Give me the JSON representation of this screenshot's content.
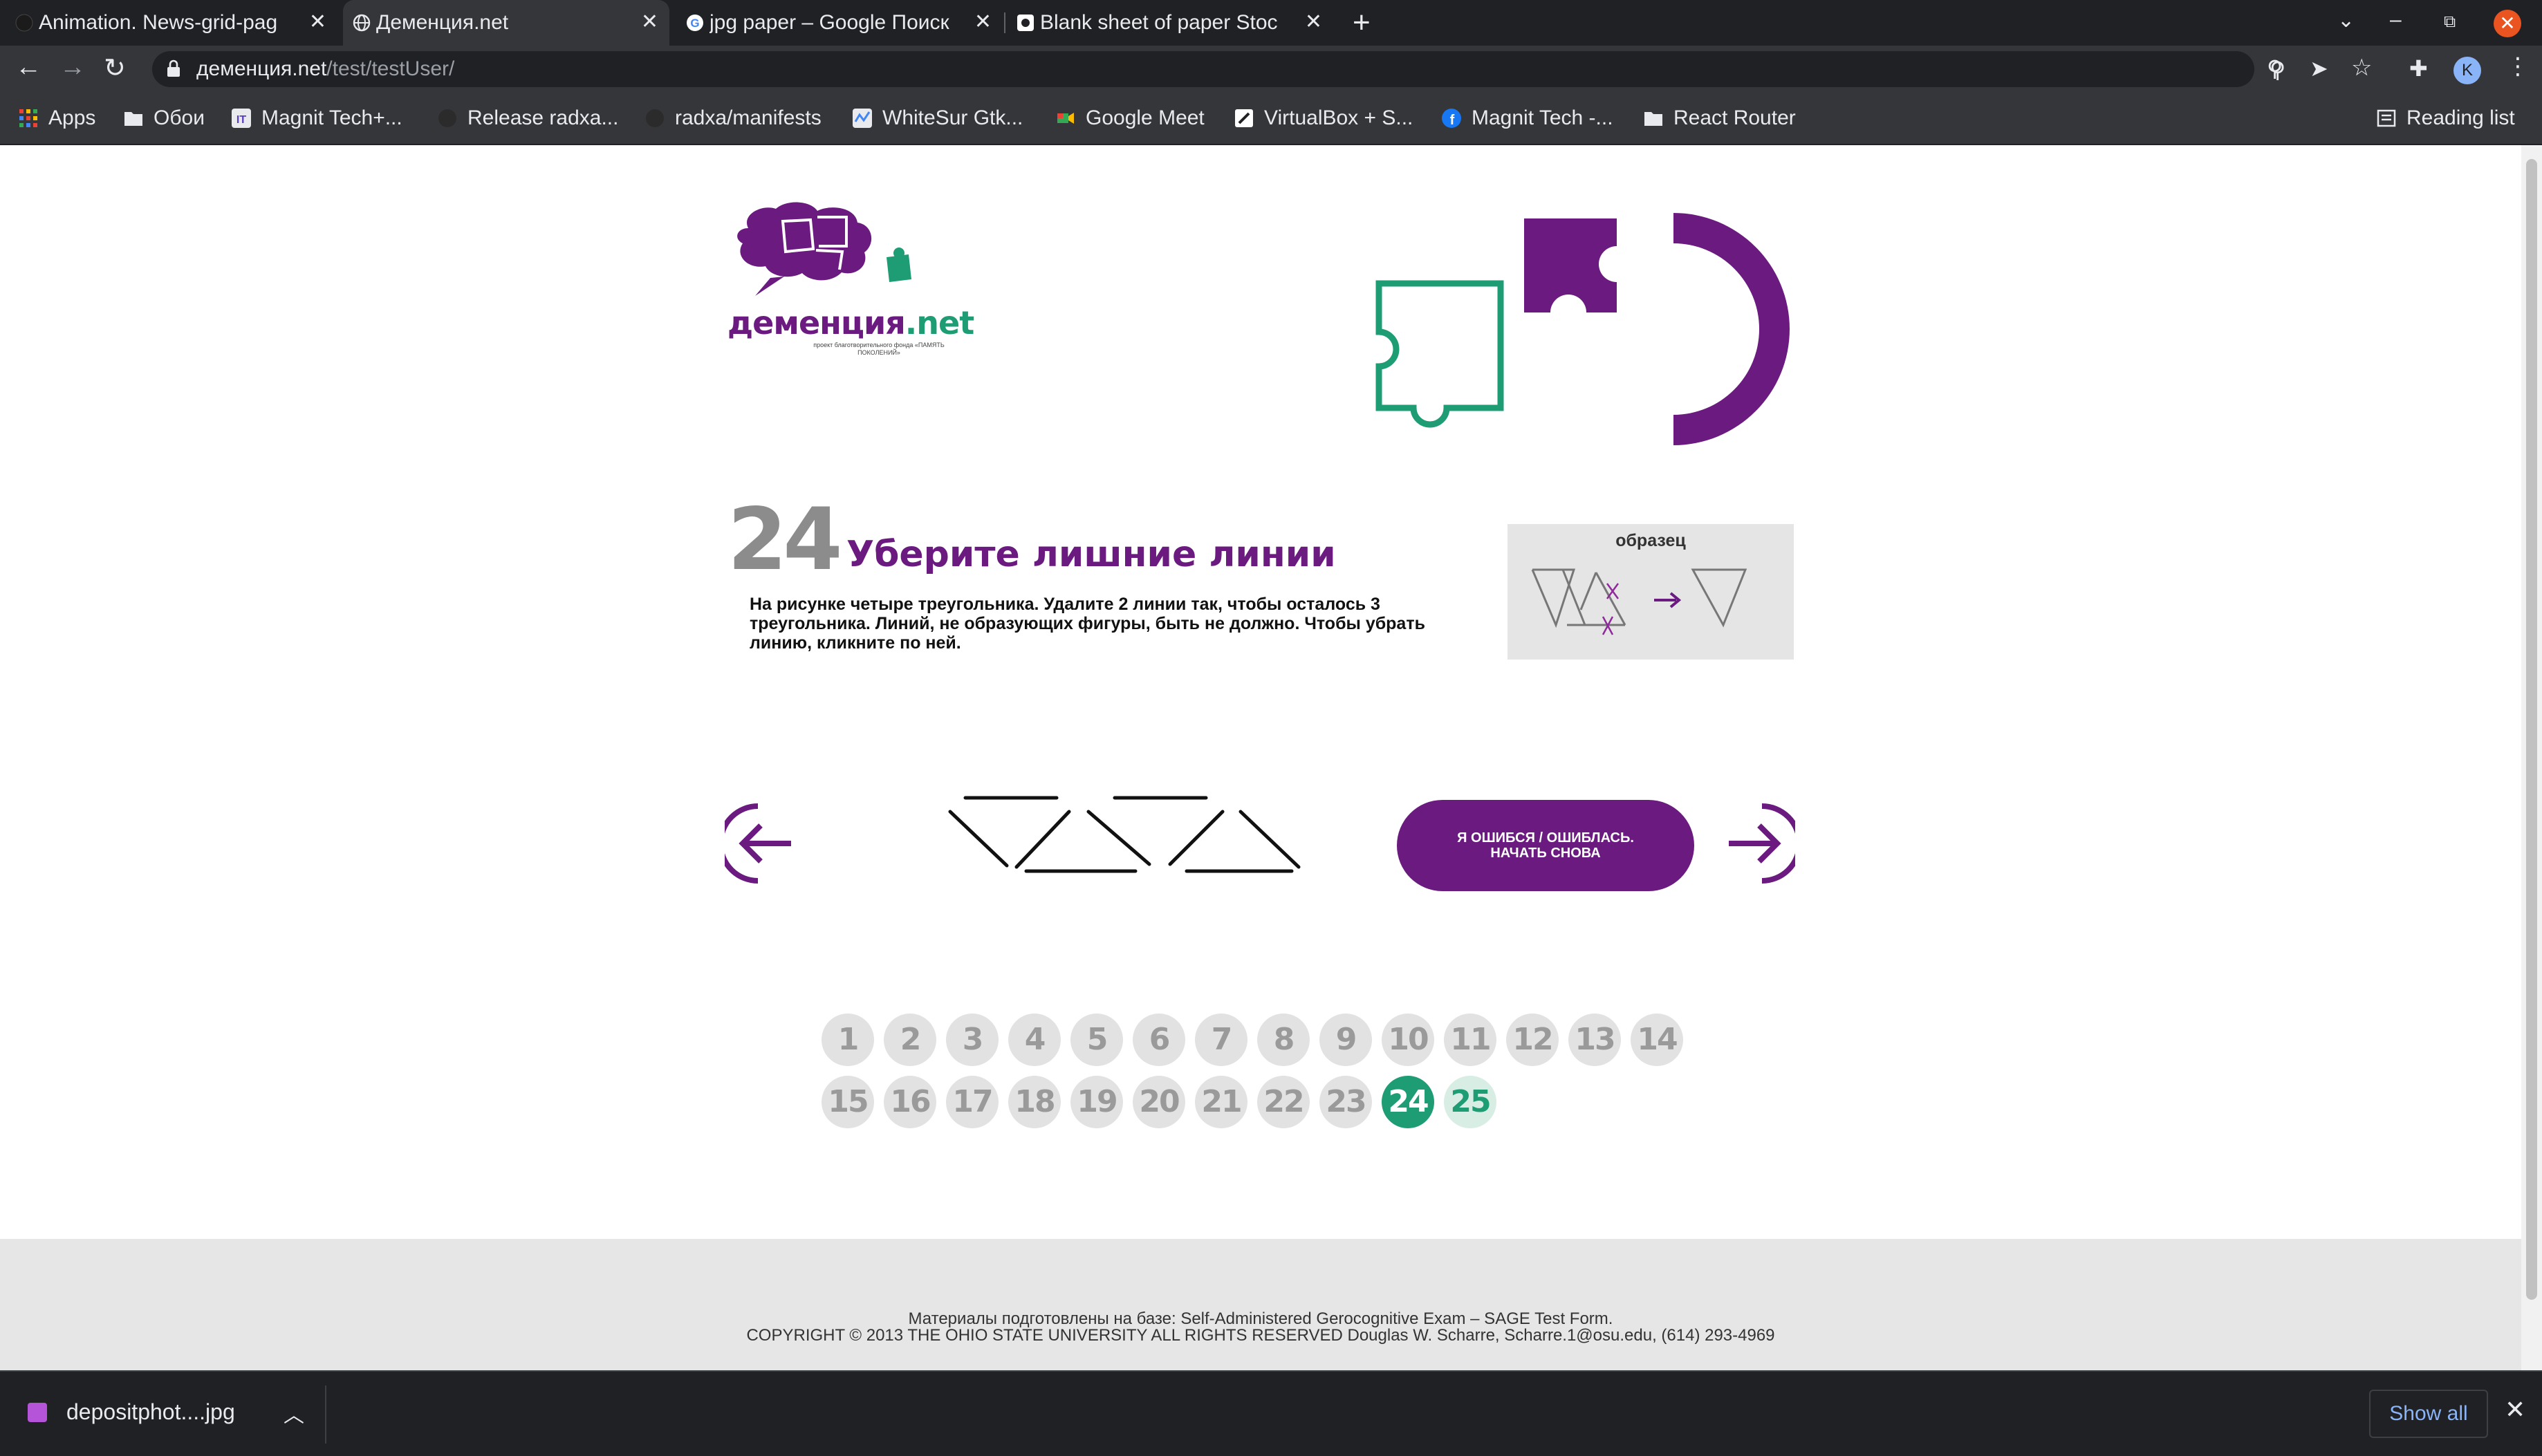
{
  "browser": {
    "tabs": [
      {
        "label": "Animation. News-grid-pag",
        "icon": "github-icon",
        "active": false
      },
      {
        "label": "Деменция.net",
        "icon": "globe-icon",
        "active": true
      },
      {
        "label": "jpg paper – Google Поиск",
        "icon": "google-icon",
        "active": false
      },
      {
        "label": "Blank sheet of paper Stoc",
        "icon": "depositphotos-icon",
        "active": false
      }
    ],
    "new_tab": "+",
    "window_controls": {
      "chevron": "⌄",
      "minimize": "–",
      "restore": "⧉",
      "close": "✕"
    },
    "url_host": "деменция.net",
    "url_path": "/test/testUser/",
    "avatar_letter": "K",
    "bookmarks": [
      {
        "label": "Apps",
        "icon": "apps-grid-icon"
      },
      {
        "label": "Обои",
        "icon": "folder-icon"
      },
      {
        "label": "Magnit Tech+...",
        "icon": "magnit-icon"
      },
      {
        "label": "Release radxa...",
        "icon": "github-icon"
      },
      {
        "label": "radxa/manifests",
        "icon": "github-icon"
      },
      {
        "label": "WhiteSur Gtk...",
        "icon": "whitesur-icon"
      },
      {
        "label": "Google Meet",
        "icon": "meet-icon"
      },
      {
        "label": "VirtualBox + S...",
        "icon": "virtualbox-icon"
      },
      {
        "label": "Magnit Tech -...",
        "icon": "facebook-icon"
      },
      {
        "label": "React Router",
        "icon": "folder-icon"
      }
    ],
    "reading_list": "Reading list"
  },
  "page": {
    "logo": {
      "title": "деменция",
      "title_suffix": ".net",
      "subtitle": "проект благотворительного фонда «ПАМЯТЬ ПОКОЛЕНИЙ»"
    },
    "question": {
      "number": "24",
      "title": "Уберите лишние линии",
      "text": "На рисунке четыре треугольника. Удалите 2 линии так, чтобы осталось 3 треугольника. Линий, не образующих фигуры, быть не должно. Чтобы убрать линию, кликните по ней."
    },
    "sample_label": "образец",
    "restart_line1": "Я ОШИБСЯ / ОШИБЛАСЬ.",
    "restart_line2": "НАЧАТЬ СНОВА",
    "pager": {
      "items": [
        "1",
        "2",
        "3",
        "4",
        "5",
        "6",
        "7",
        "8",
        "9",
        "10",
        "11",
        "12",
        "13",
        "14",
        "15",
        "16",
        "17",
        "18",
        "19",
        "20",
        "21",
        "22",
        "23",
        "24",
        "25"
      ],
      "current": "24",
      "next": "25"
    },
    "footer_line1": "Материалы подготовлены на базе: Self-Administered Gerocognitive Exam – SAGE Test Form.",
    "footer_line2": "COPYRIGHT © 2013 THE OHIO STATE UNIVERSITY ALL RIGHTS RESERVED Douglas W. Scharre, Scharre.1@osu.edu, (614) 293-4969",
    "colors": {
      "purple": "#6b1a80",
      "green": "#1e9c74",
      "grey": "#8c8c8c"
    }
  },
  "downloads": {
    "file": "depositphot....jpg",
    "show_all": "Show all"
  }
}
